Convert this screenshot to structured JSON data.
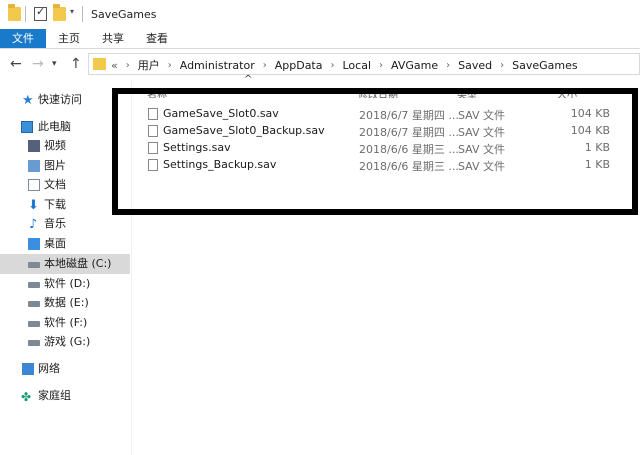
{
  "window": {
    "title": "SaveGames"
  },
  "ribbon": {
    "tabs": [
      "文件",
      "主页",
      "共享",
      "查看"
    ]
  },
  "address": {
    "prefix": "«",
    "crumbs": [
      "用户",
      "Administrator",
      "AppData",
      "Local",
      "AVGame",
      "Saved",
      "SaveGames"
    ]
  },
  "columns": {
    "name": "名称",
    "date": "修改日期",
    "type": "类型",
    "size": "大小"
  },
  "files": [
    {
      "name": "GameSave_Slot0.sav",
      "date": "2018/6/7 星期四 ...",
      "type": "SAV 文件",
      "size": "104 KB"
    },
    {
      "name": "GameSave_Slot0_Backup.sav",
      "date": "2018/6/7 星期四 ...",
      "type": "SAV 文件",
      "size": "104 KB"
    },
    {
      "name": "Settings.sav",
      "date": "2018/6/6 星期三 ...",
      "type": "SAV 文件",
      "size": "1 KB"
    },
    {
      "name": "Settings_Backup.sav",
      "date": "2018/6/6 星期三 ...",
      "type": "SAV 文件",
      "size": "1 KB"
    }
  ],
  "sidebar": {
    "quick_access": "快速访问",
    "this_pc": "此电脑",
    "items": [
      {
        "label": "视频",
        "icon": "video-icon"
      },
      {
        "label": "图片",
        "icon": "pictures-icon"
      },
      {
        "label": "文档",
        "icon": "documents-icon"
      },
      {
        "label": "下载",
        "icon": "downloads-icon"
      },
      {
        "label": "音乐",
        "icon": "music-icon"
      },
      {
        "label": "桌面",
        "icon": "desktop-icon"
      }
    ],
    "drives": [
      {
        "label": "本地磁盘 (C:)",
        "selected": true
      },
      {
        "label": "软件 (D:)",
        "selected": false
      },
      {
        "label": "数据 (E:)",
        "selected": false
      },
      {
        "label": "软件 (F:)",
        "selected": false
      },
      {
        "label": "游戏 (G:)",
        "selected": false
      }
    ],
    "network": "网络",
    "homegroup": "家庭组"
  },
  "colors": {
    "file_tab": "#1979ca",
    "highlight_border": "#000000",
    "selected_bg": "#d9d9d9"
  }
}
